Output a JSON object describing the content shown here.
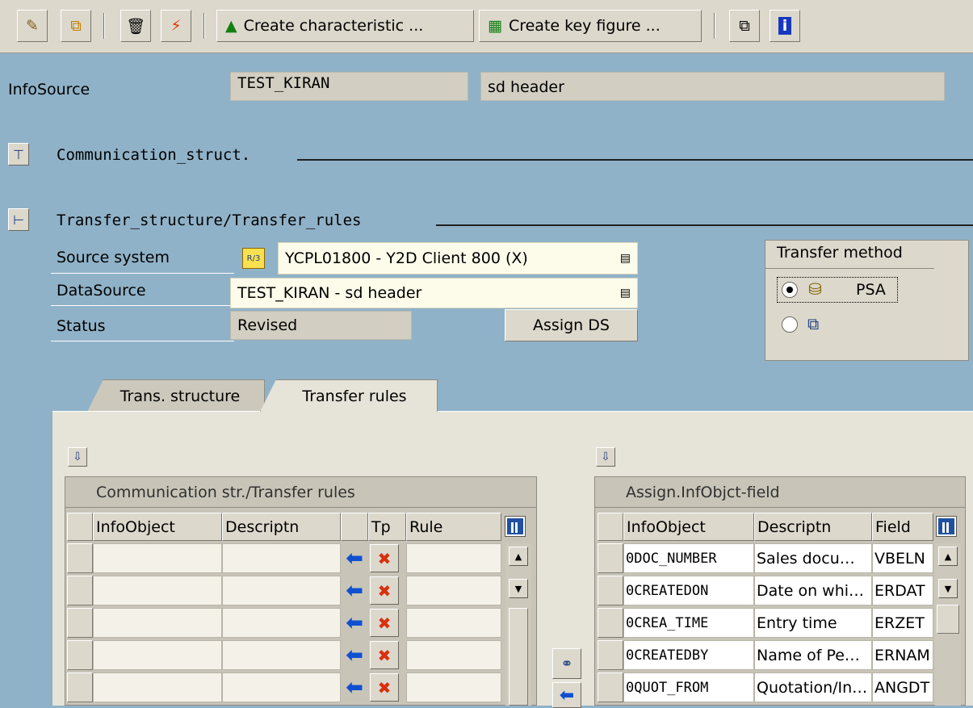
{
  "toolbar": {
    "create_characteristic_label": "Create characteristic ...",
    "create_key_figure_label": "Create key figure ..."
  },
  "header": {
    "infosource_label": "InfoSource",
    "infosource_id": "TEST_KIRAN",
    "infosource_text": "sd header"
  },
  "sections": {
    "communication_struct": "Communication_struct.",
    "transfer_structure": "Transfer_structure/Transfer_rules"
  },
  "form": {
    "source_system_label": "Source system",
    "source_system_value": "YCPL01800 - Y2D Client 800 (X)",
    "datasource_label": "DataSource",
    "datasource_value": "TEST_KIRAN - sd header",
    "status_label": "Status",
    "status_value": "Revised",
    "assign_ds_label": "Assign DS"
  },
  "transfer_method": {
    "title": "Transfer method",
    "psa_label": "PSA",
    "selected": "PSA"
  },
  "tabs": [
    {
      "label": "Trans. structure",
      "active": false
    },
    {
      "label": "Transfer rules",
      "active": true
    }
  ],
  "left_table": {
    "caption": "Communication str./Transfer rules",
    "columns": [
      "InfoObject",
      "Descriptn",
      "Tp",
      "Rule"
    ],
    "rows": [
      {
        "infoobject": "",
        "descr": "",
        "rule": ""
      },
      {
        "infoobject": "",
        "descr": "",
        "rule": ""
      },
      {
        "infoobject": "",
        "descr": "",
        "rule": ""
      },
      {
        "infoobject": "",
        "descr": "",
        "rule": ""
      },
      {
        "infoobject": "",
        "descr": "",
        "rule": ""
      }
    ]
  },
  "right_table": {
    "caption": "Assign.InfObjct-field",
    "columns": [
      "InfoObject",
      "Descriptn",
      "Field"
    ],
    "rows": [
      {
        "infoobject": "0DOC_NUMBER",
        "descr": "Sales docu…",
        "field": "VBELN"
      },
      {
        "infoobject": "0CREATEDON",
        "descr": "Date on whi…",
        "field": "ERDAT"
      },
      {
        "infoobject": "0CREA_TIME",
        "descr": "Entry time",
        "field": "ERZET"
      },
      {
        "infoobject": "0CREATEDBY",
        "descr": "Name of Pe…",
        "field": "ERNAM"
      },
      {
        "infoobject": "0QUOT_FROM",
        "descr": "Quotation/In…",
        "field": "ANGDT"
      }
    ]
  },
  "colors": {
    "background": "#90b2c8",
    "arrow": "#1050d0",
    "delete": "#d83010"
  }
}
